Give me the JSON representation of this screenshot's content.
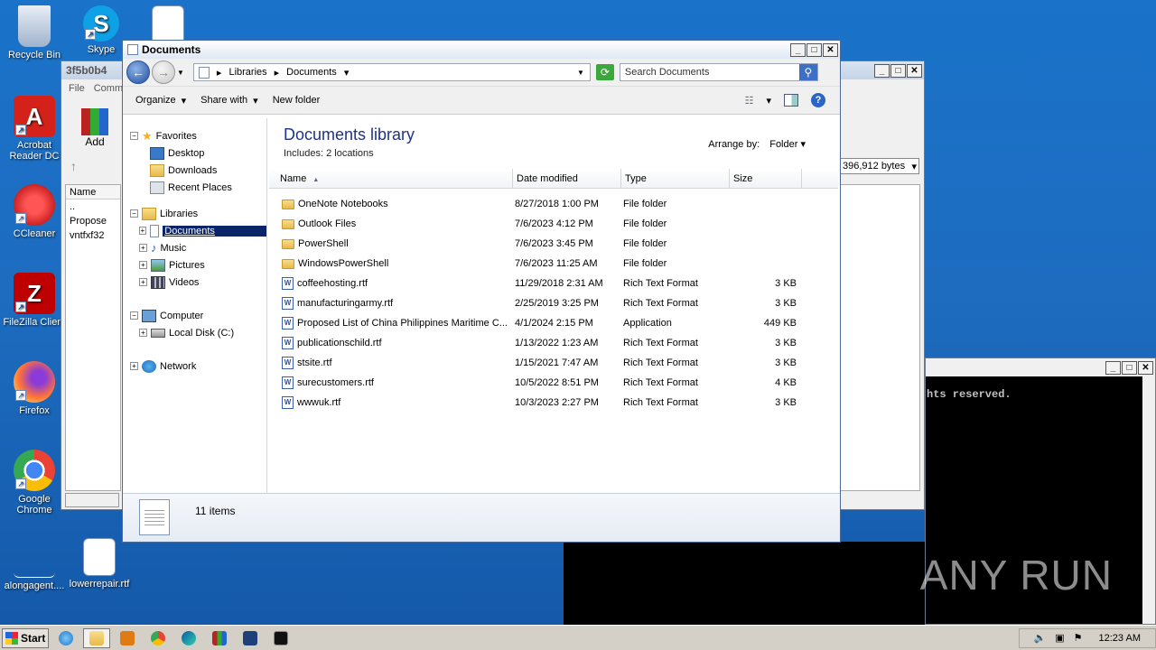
{
  "desktop": {
    "icons": [
      {
        "label": "Recycle Bin"
      },
      {
        "label": "Skype"
      },
      {
        "label": "Acrobat Reader DC"
      },
      {
        "label": "CCleaner"
      },
      {
        "label": "FileZilla Client"
      },
      {
        "label": "Firefox"
      },
      {
        "label": "Google Chrome"
      },
      {
        "label": "alongagent...."
      },
      {
        "label": "lowerrepair.rtf"
      }
    ]
  },
  "archive_window": {
    "title": "3f5b0b4",
    "menu": [
      "File",
      "Comm"
    ],
    "add_label": "Add",
    "size_text": "396,912 bytes",
    "col_name": "Name",
    "items": [
      "..",
      "Propose",
      "vntfxf32"
    ]
  },
  "console_window": {
    "text": "hts reserved."
  },
  "explorer": {
    "title": "Documents",
    "address": {
      "crumbs": [
        "Libraries",
        "Documents"
      ]
    },
    "search_placeholder": "Search Documents",
    "toolbar": {
      "organize": "Organize",
      "share": "Share with",
      "new_folder": "New folder"
    },
    "nav": {
      "favorites": "Favorites",
      "desktop": "Desktop",
      "downloads": "Downloads",
      "recent": "Recent Places",
      "libraries": "Libraries",
      "documents": "Documents",
      "music": "Music",
      "pictures": "Pictures",
      "videos": "Videos",
      "computer": "Computer",
      "local_disk": "Local Disk (C:)",
      "network": "Network"
    },
    "library_title": "Documents library",
    "library_sub": "Includes:  2 locations",
    "arrange_label": "Arrange by:",
    "arrange_value": "Folder",
    "columns": {
      "name": "Name",
      "date": "Date modified",
      "type": "Type",
      "size": "Size"
    },
    "files": [
      {
        "name": "OneNote Notebooks",
        "date": "8/27/2018 1:00 PM",
        "type": "File folder",
        "size": "",
        "icon": "folder-icon"
      },
      {
        "name": "Outlook Files",
        "date": "7/6/2023 4:12 PM",
        "type": "File folder",
        "size": "",
        "icon": "folder-icon"
      },
      {
        "name": "PowerShell",
        "date": "7/6/2023 3:45 PM",
        "type": "File folder",
        "size": "",
        "icon": "folder-icon"
      },
      {
        "name": "WindowsPowerShell",
        "date": "7/6/2023 11:25 AM",
        "type": "File folder",
        "size": "",
        "icon": "folder-icon"
      },
      {
        "name": "coffeehosting.rtf",
        "date": "11/29/2018 2:31 AM",
        "type": "Rich Text Format",
        "size": "3 KB",
        "icon": "word-doc-icon"
      },
      {
        "name": "manufacturingarmy.rtf",
        "date": "2/25/2019 3:25 PM",
        "type": "Rich Text Format",
        "size": "3 KB",
        "icon": "word-doc-icon"
      },
      {
        "name": "Proposed List of China Philippines Maritime C...",
        "date": "4/1/2024 2:15 PM",
        "type": "Application",
        "size": "449 KB",
        "icon": "application-icon"
      },
      {
        "name": "publicationschild.rtf",
        "date": "1/13/2022 1:23 AM",
        "type": "Rich Text Format",
        "size": "3 KB",
        "icon": "word-doc-icon"
      },
      {
        "name": "stsite.rtf",
        "date": "1/15/2021 7:47 AM",
        "type": "Rich Text Format",
        "size": "3 KB",
        "icon": "word-doc-icon"
      },
      {
        "name": "surecustomers.rtf",
        "date": "10/5/2022 8:51 PM",
        "type": "Rich Text Format",
        "size": "4 KB",
        "icon": "word-doc-icon"
      },
      {
        "name": "wwwuk.rtf",
        "date": "10/3/2023 2:27 PM",
        "type": "Rich Text Format",
        "size": "3 KB",
        "icon": "word-doc-icon"
      }
    ],
    "status": "11 items"
  },
  "taskbar": {
    "start_label": "Start",
    "clock": "12:23 AM"
  },
  "watermark": "ANY RUN"
}
